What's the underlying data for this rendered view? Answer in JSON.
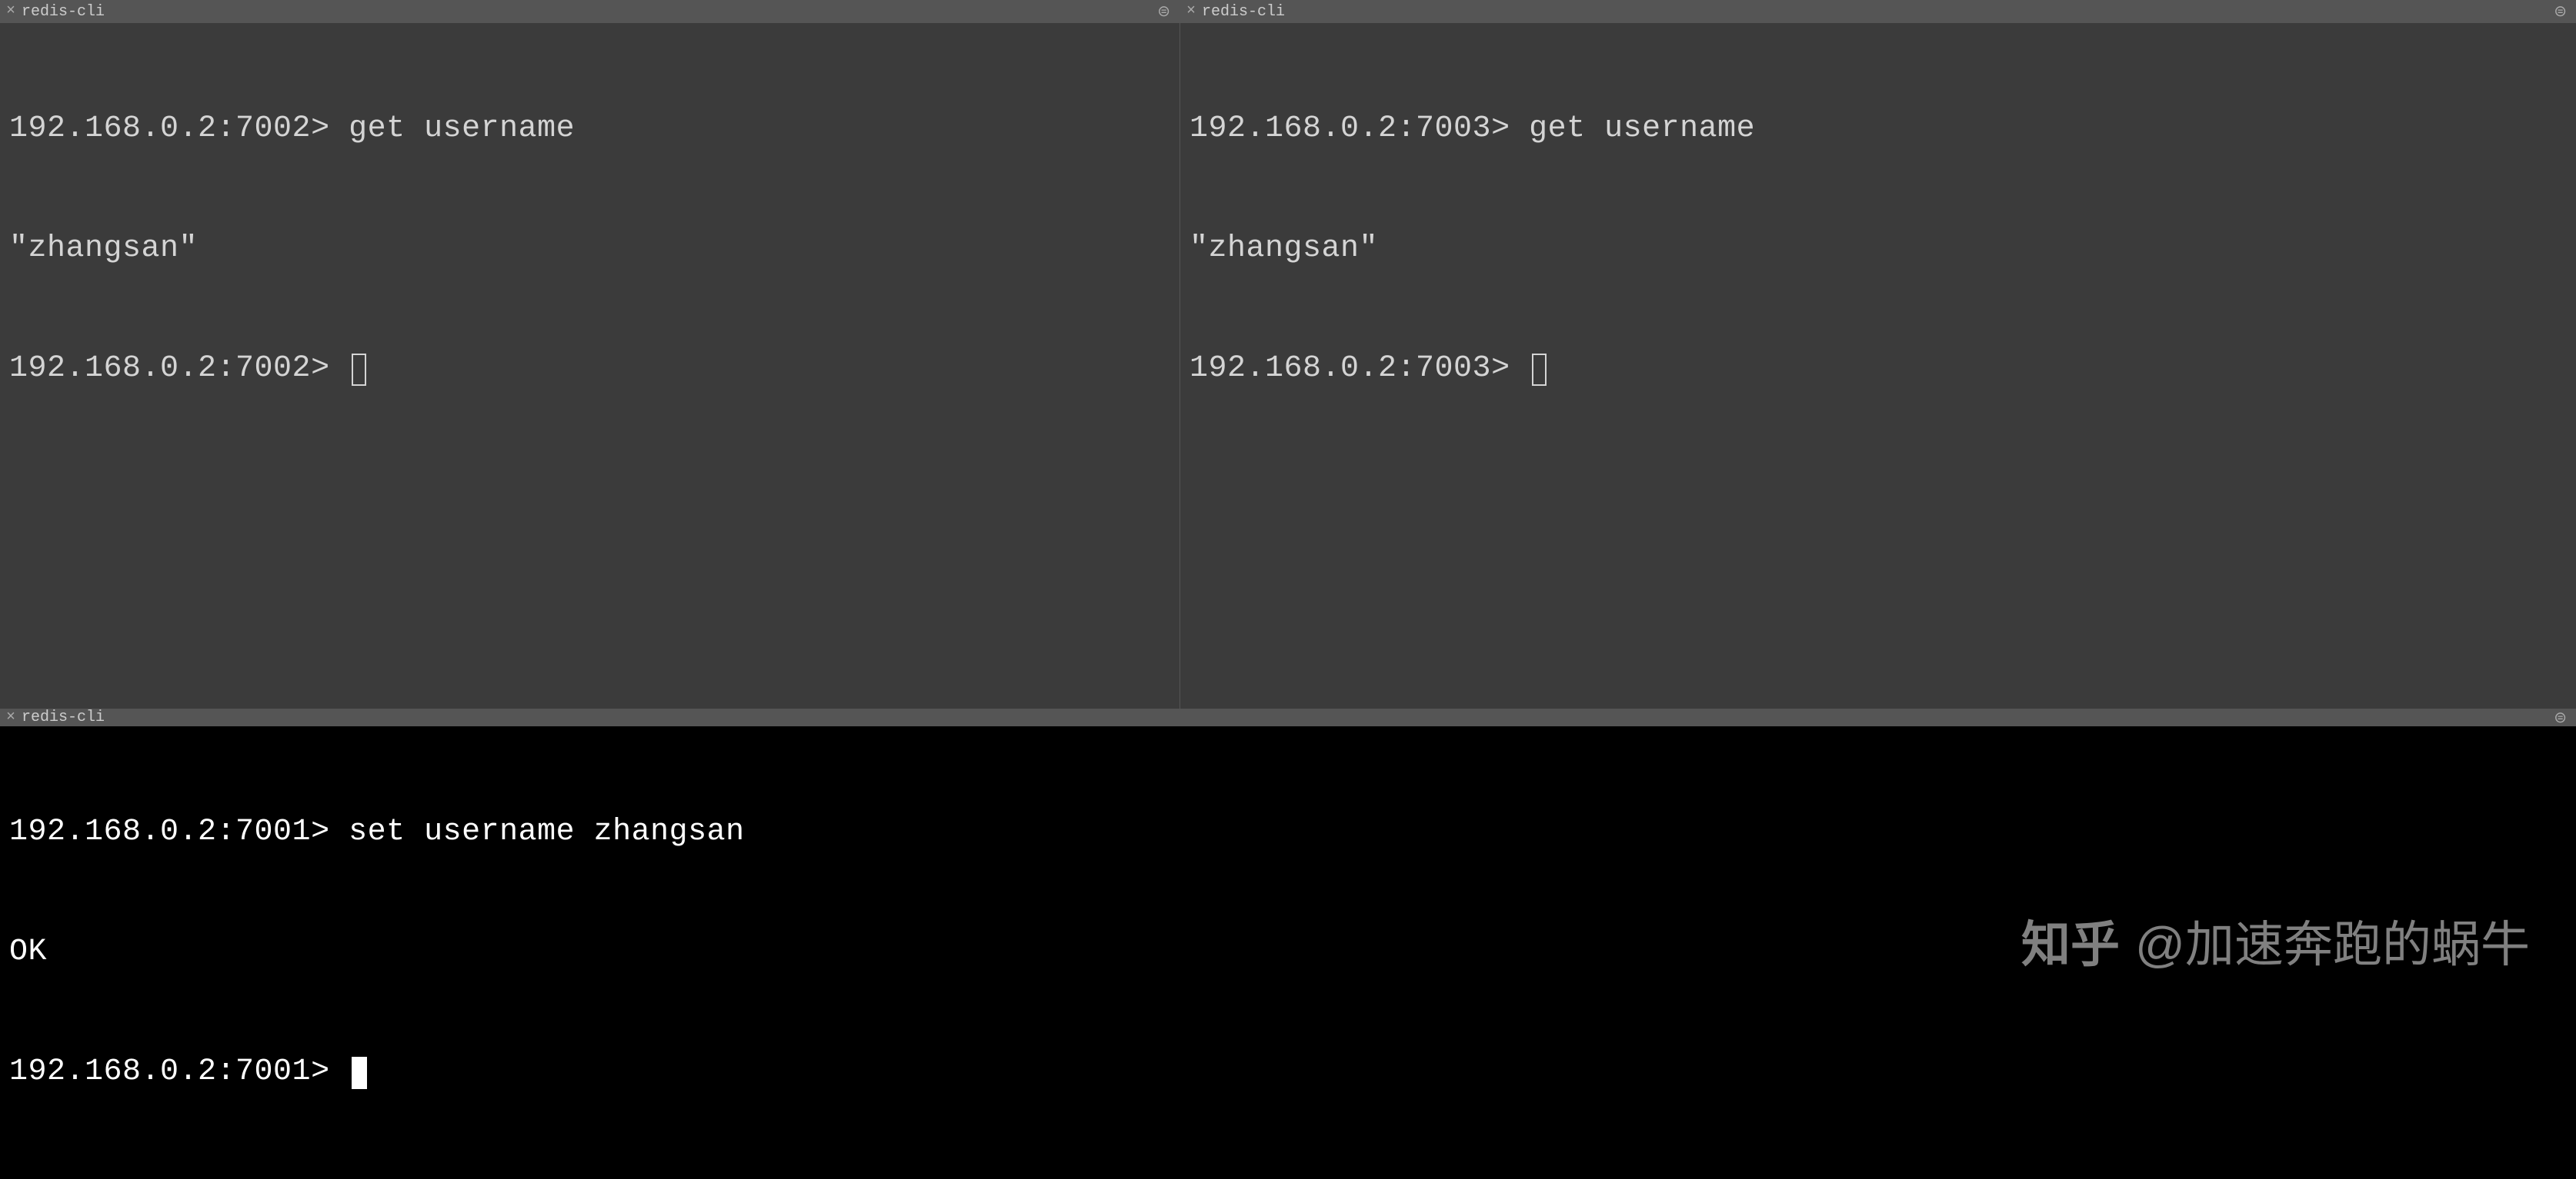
{
  "panes": {
    "top_left": {
      "tab_title": "redis-cli",
      "lines": [
        {
          "prompt": "192.168.0.2:7002>",
          "command": " get username"
        },
        {
          "output": "\"zhangsan\""
        },
        {
          "prompt": "192.168.0.2:7002>",
          "command": " ",
          "cursor": "box"
        }
      ]
    },
    "top_right": {
      "tab_title": "redis-cli",
      "lines": [
        {
          "prompt": "192.168.0.2:7003>",
          "command": " get username"
        },
        {
          "output": "\"zhangsan\""
        },
        {
          "prompt": "192.168.0.2:7003>",
          "command": " ",
          "cursor": "box"
        }
      ]
    },
    "bottom": {
      "tab_title": "redis-cli",
      "lines": [
        {
          "prompt": "192.168.0.2:7001>",
          "command": " set username zhangsan"
        },
        {
          "output": "OK"
        },
        {
          "prompt": "192.168.0.2:7001>",
          "command": " ",
          "cursor": "block"
        }
      ]
    }
  },
  "watermark": {
    "logo": "知乎",
    "author": "@加速奔跑的蜗牛"
  }
}
